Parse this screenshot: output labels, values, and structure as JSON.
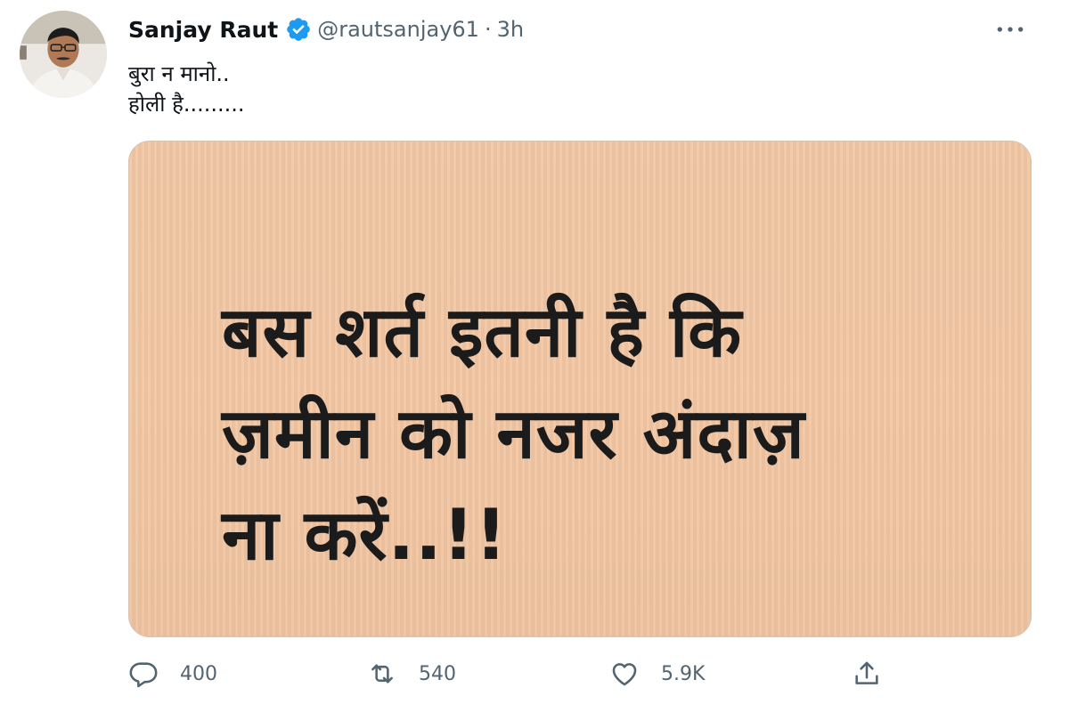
{
  "tweet": {
    "author": {
      "name": "Sanjay Raut",
      "handle": "@rautsanjay61",
      "separator": "·",
      "timestamp": "3h",
      "verified": true
    },
    "text_lines": [
      "बुरा न मानो..",
      "होली है........."
    ],
    "media": {
      "lines": [
        "बस शर्त इतनी है कि",
        "ज़मीन को नजर अंदाज़",
        "ना करें..!!"
      ],
      "background_color": "#f2c7a4"
    },
    "actions": {
      "reply": {
        "count": "400",
        "icon": "reply-icon"
      },
      "retweet": {
        "count": "540",
        "icon": "retweet-icon"
      },
      "like": {
        "count": "5.9K",
        "icon": "heart-icon"
      },
      "share": {
        "icon": "share-icon"
      }
    },
    "more_icon": "more-icon",
    "colors": {
      "verified_badge": "#1d9bf0",
      "secondary_text": "#536471",
      "primary_text": "#0f1419"
    }
  }
}
